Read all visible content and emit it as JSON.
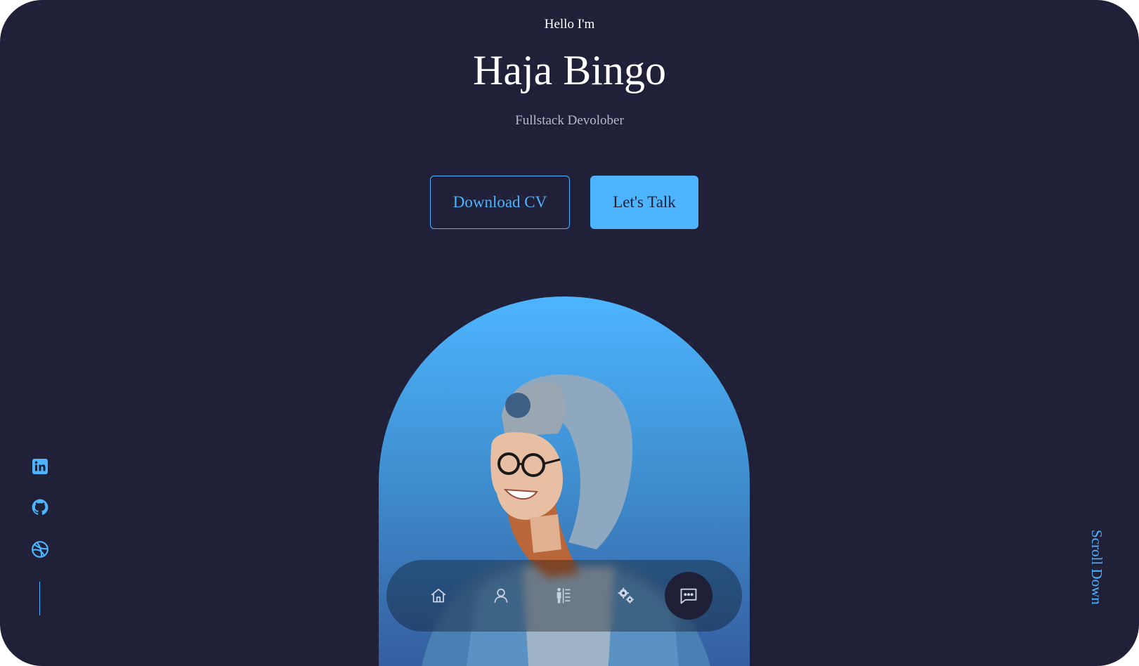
{
  "header": {
    "greeting": "Hello I'm",
    "name": "Haja Bingo",
    "role": "Fullstack Devolober"
  },
  "cta": {
    "download_label": "Download CV",
    "talk_label": "Let's Talk"
  },
  "socials": [
    {
      "icon": "linkedin-icon"
    },
    {
      "icon": "github-icon"
    },
    {
      "icon": "dribbble-icon"
    }
  ],
  "scroll_label": "Scroll Down",
  "nav": {
    "items": [
      {
        "icon": "home-icon",
        "active": false
      },
      {
        "icon": "user-icon",
        "active": false
      },
      {
        "icon": "experience-icon",
        "active": false
      },
      {
        "icon": "services-gears-icon",
        "active": false
      },
      {
        "icon": "chat-message-icon",
        "active": true
      }
    ]
  },
  "colors": {
    "background": "#1f1f38",
    "accent": "#4db5ff",
    "text": "#ffffff",
    "muted_text": "#b8b8c8"
  }
}
